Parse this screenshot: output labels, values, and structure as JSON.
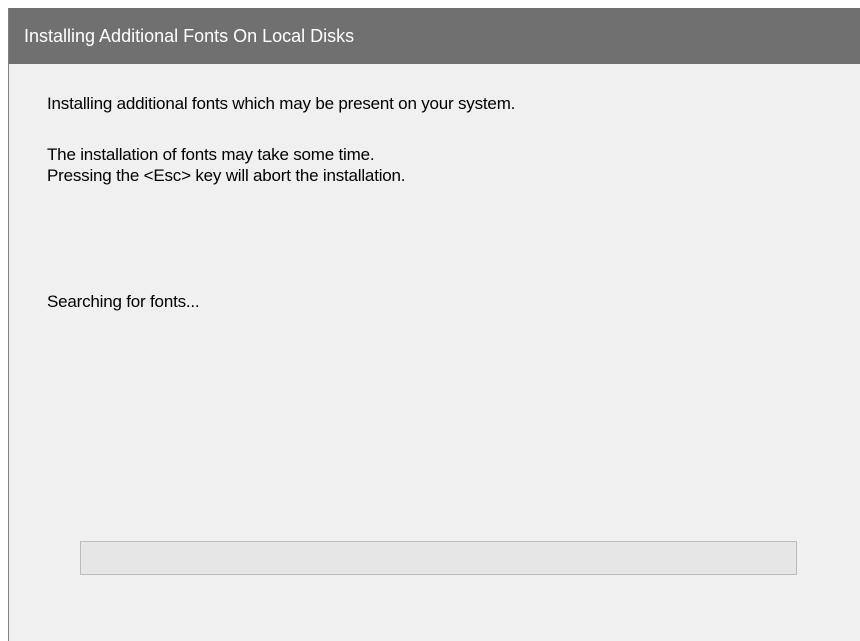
{
  "dialog": {
    "title": "Installing Additional Fonts On Local Disks",
    "message_intro": "Installing additional  fonts which may be present on your system.",
    "message_time": "The installation of fonts may take some time.",
    "message_abort": "Pressing the <Esc> key will abort the installation.",
    "status": "Searching for fonts...",
    "progress_percent": 0
  },
  "colors": {
    "titlebar_bg": "#707070",
    "titlebar_text": "#ffffff",
    "window_bg": "#f0f0f0",
    "progress_track": "#e6e6e6",
    "progress_border": "#bcbcbc",
    "progress_fill": "#06b025"
  }
}
